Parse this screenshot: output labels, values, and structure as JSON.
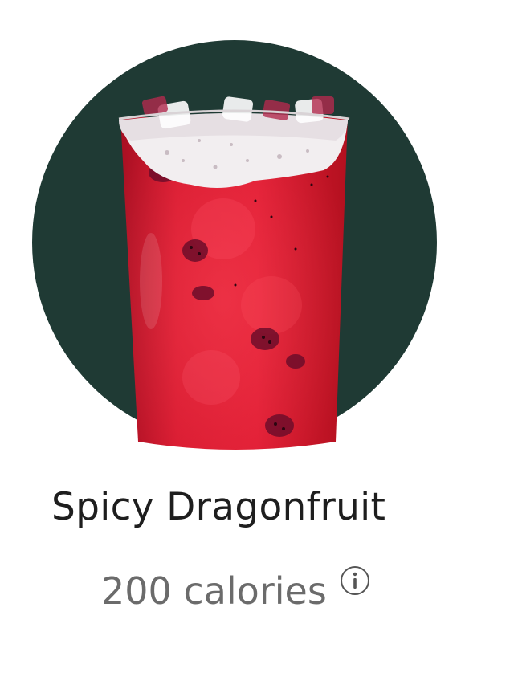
{
  "product": {
    "name": "Spicy Dragonfruit",
    "calories": "200 calories",
    "image_icon": "dragonfruit-drink-cup",
    "info_icon": "info-icon"
  },
  "colors": {
    "circle_background": "#1f3a34",
    "drink": "#d2162b",
    "foam": "#f2eef0",
    "text_primary": "#1e1e1e",
    "text_secondary": "#6b6b6b"
  }
}
